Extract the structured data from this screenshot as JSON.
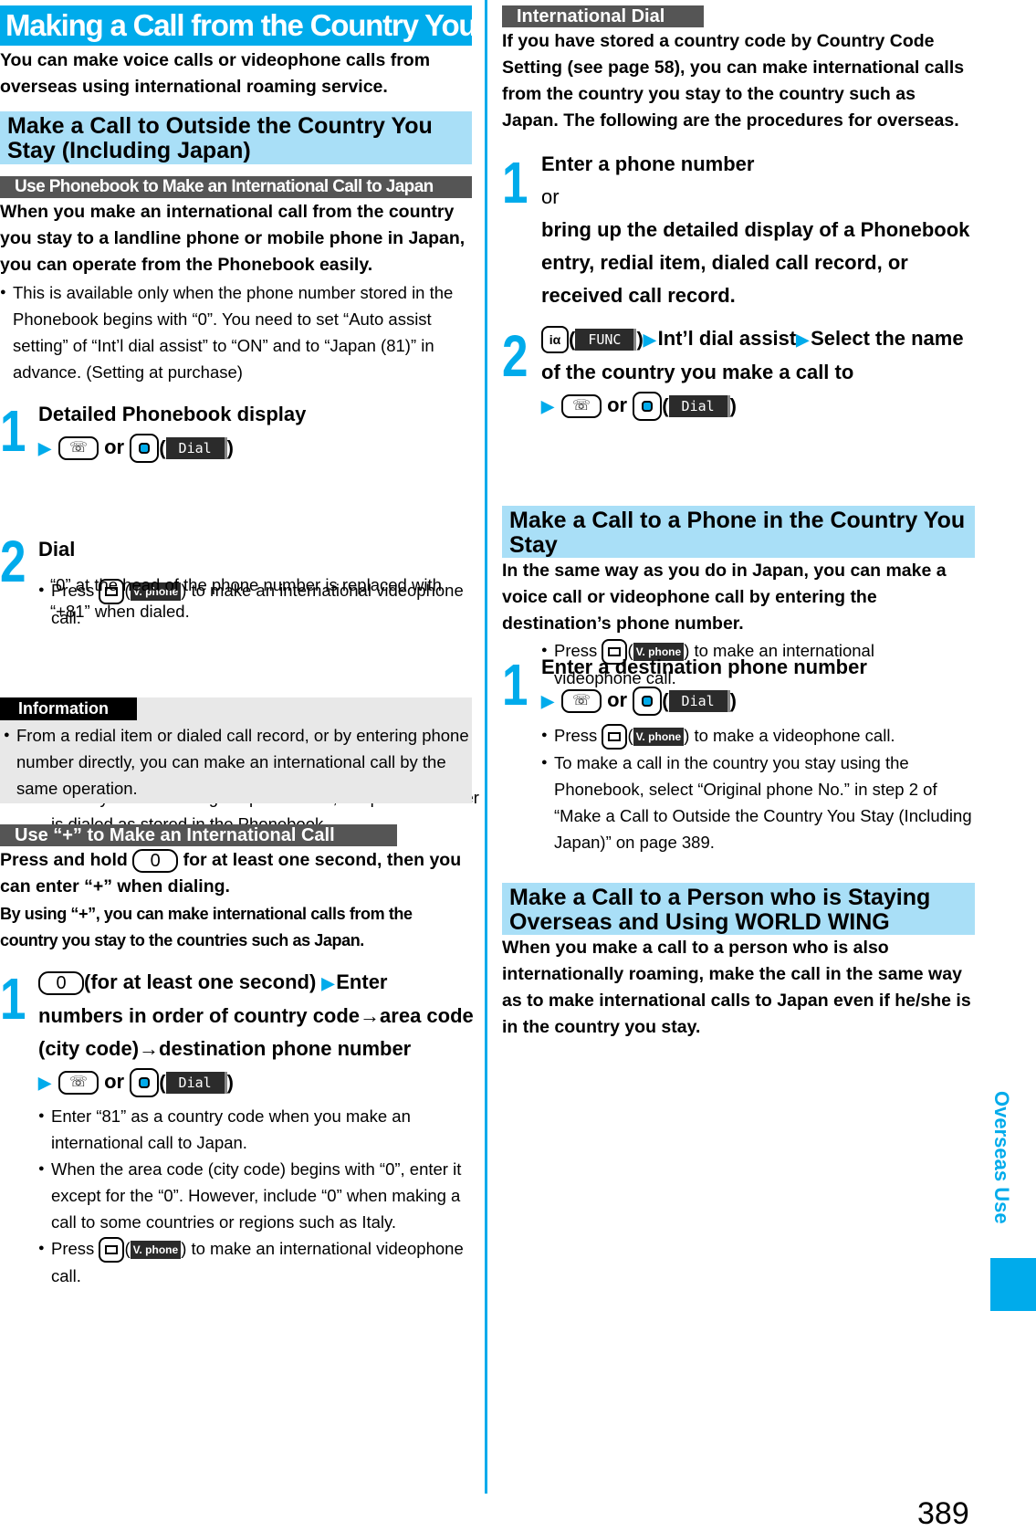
{
  "page": {
    "title": "Making a Call from the Country You Stay",
    "intro": "You can make voice calls or videophone calls from overseas using international roaming service.",
    "page_number": "389",
    "side_tab_label": "Overseas Use",
    "accent_color": "#00ABEB"
  },
  "left": {
    "section1": {
      "heading": "Make a Call to Outside the Country You Stay (Including Japan)",
      "subheading": "Use Phonebook to Make an International Call to Japan",
      "lead": "When you make an international call from the country you stay to a landline phone or mobile phone in Japan, you can operate from the Phonebook easily.",
      "note": "This is available only when the phone number stored in the Phonebook begins with “0”. You need to set “Auto assist setting” of “Int’l dial assist” to “ON” and to “Japan (81)” in advance. (Setting at purchase)",
      "step1": {
        "num": "1",
        "text": "Detailed Phonebook display",
        "or": "or",
        "dial_label": "Dial",
        "bullet_press": "Press",
        "vphone_label": "V. phone",
        "bullet_rest": ") to make an international videophone call."
      },
      "step2": {
        "num": "2",
        "text": "Dial",
        "body": "“0” at the head of the phone number is replaced with “+81” when dialed.",
        "bullet": "When you select “Original phone No.”, the phone number is dialed as stored in the Phonebook."
      },
      "info": {
        "label": "Information",
        "bullet": "From a redial item or dialed call record, or by entering phone number directly, you can make an international call by the same operation."
      }
    },
    "section2": {
      "subheading": "Use “+” to Make an International Call",
      "lead_a": "Press and hold",
      "zero_key": "0",
      "lead_b": "for at least one second, then you can enter “+” when dialing.",
      "lead2": "By using “+”, you can make international calls from the country you stay to the countries such as Japan.",
      "step1": {
        "num": "1",
        "text_a": "(for at least one second)",
        "text_b": "Enter numbers in order of country code→area code (city code)→destination phone number",
        "or": "or",
        "dial_label": "Dial",
        "bullets": [
          "Enter “81” as a country code when you make an international call to Japan.",
          "When the area code (city code) begins with “0”, enter it except for the “0”. However, include “0” when making a call to some countries or regions such as Italy."
        ],
        "bullet_press": "Press",
        "vphone_label": "V. phone",
        "bullet_rest": ") to make an international videophone call."
      }
    }
  },
  "right": {
    "intl_dial": {
      "subheading": "International Dial",
      "lead": "If you have stored a country code by Country Code Setting (see page 58), you can make international calls from the country you stay to the country such as Japan. The following are the procedures for overseas.",
      "step1": {
        "num": "1",
        "text_a": "Enter a phone number",
        "or": "or",
        "text_b": "bring up the detailed display of a Phonebook entry, redial item, dialed call record, or received call record."
      },
      "step2": {
        "num": "2",
        "ia_key": "iα",
        "func_label": "FUNC",
        "text_a": "Int’l dial assist",
        "text_b": "Select the name of the country you make a call to",
        "or": "or",
        "dial_label": "Dial",
        "bullet_press": "Press",
        "vphone_label": "V. phone",
        "bullet_rest": ") to make an international videophone call."
      }
    },
    "section_local": {
      "heading": "Make a Call to a Phone in the Country You Stay",
      "lead": "In the same way as you do in Japan, you can make a voice call or videophone call by entering the destination’s phone number.",
      "step1": {
        "num": "1",
        "text": "Enter a destination phone number",
        "or": "or",
        "dial_label": "Dial",
        "bullet_press": "Press",
        "vphone_label": "V. phone",
        "bullet_rest": ") to make a videophone call.",
        "bullet2": "To make a call in the country you stay using the Phonebook, select “Original phone No.” in step 2 of “Make a Call to Outside the Country You Stay (Including Japan)” on page 389."
      }
    },
    "section_world": {
      "heading": "Make a Call to a Person who is Staying Overseas and Using WORLD WING",
      "lead": "When you make a call to a person who is also internationally roaming, make the call in the same way as to make international calls to Japan even if he/she is in the country you stay."
    }
  }
}
